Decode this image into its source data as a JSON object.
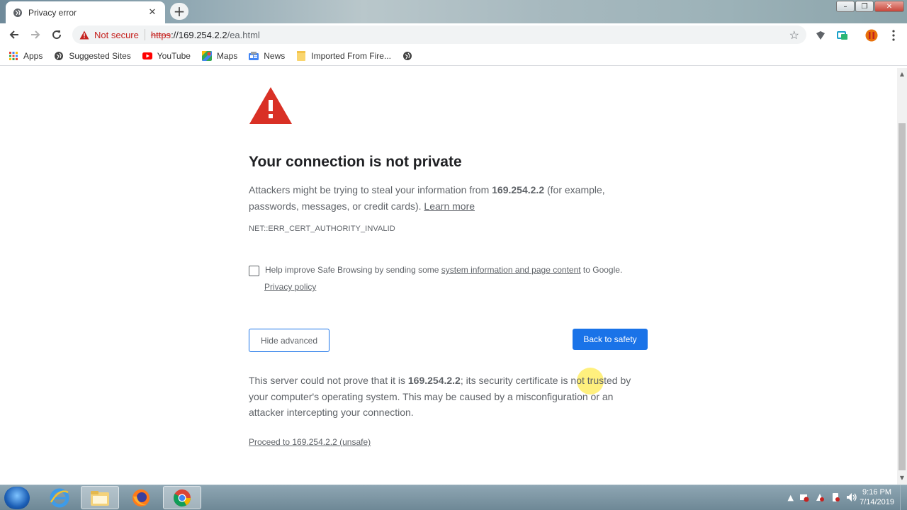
{
  "tab": {
    "title": "Privacy error",
    "close": "✕"
  },
  "newtab": "+",
  "window_controls": {
    "minimize": "–",
    "maximize": "❐",
    "close": "✕"
  },
  "omnibox": {
    "security_label": "Not secure",
    "scheme": "https",
    "host": "://169.254.2.2",
    "path": "/ea.html",
    "bookmark_star": "☆"
  },
  "bookmarks": [
    {
      "label": "Apps",
      "icon": "apps-grid-icon"
    },
    {
      "label": "Suggested Sites",
      "icon": "globe-icon"
    },
    {
      "label": "YouTube",
      "icon": "youtube-icon"
    },
    {
      "label": "Maps",
      "icon": "maps-icon"
    },
    {
      "label": "News",
      "icon": "news-icon"
    },
    {
      "label": "Imported From Fire...",
      "icon": "folder-icon"
    }
  ],
  "page": {
    "heading": "Your connection is not private",
    "explain_pre": "Attackers might be trying to steal your information from ",
    "explain_host": "169.254.2.2",
    "explain_post": " (for example, passwords, messages, or credit cards). ",
    "learn_more": "Learn more",
    "error_code": "NET::ERR_CERT_AUTHORITY_INVALID",
    "safe_browsing_pre": "Help improve Safe Browsing by sending some ",
    "safe_browsing_link": "system information and page content",
    "safe_browsing_post": " to Google.",
    "privacy_policy": "Privacy policy",
    "hide_advanced": "Hide advanced",
    "back_to_safety": "Back to safety",
    "details_pre": "This server could not prove that it is ",
    "details_host": "169.254.2.2",
    "details_post": "; its security certificate is not trusted by your computer's operating system. This may be caused by a misconfiguration or an attacker intercepting your connection.",
    "proceed": "Proceed to 169.254.2.2 (unsafe)"
  },
  "taskbar": {
    "apps": [
      "internet-explorer-icon",
      "file-explorer-icon",
      "firefox-icon",
      "chrome-icon"
    ],
    "time": "9:16 PM",
    "date": "7/14/2019"
  },
  "colors": {
    "accent_blue": "#1a73e8",
    "danger_red": "#c5221f",
    "warning_icon_red": "#d93025"
  }
}
